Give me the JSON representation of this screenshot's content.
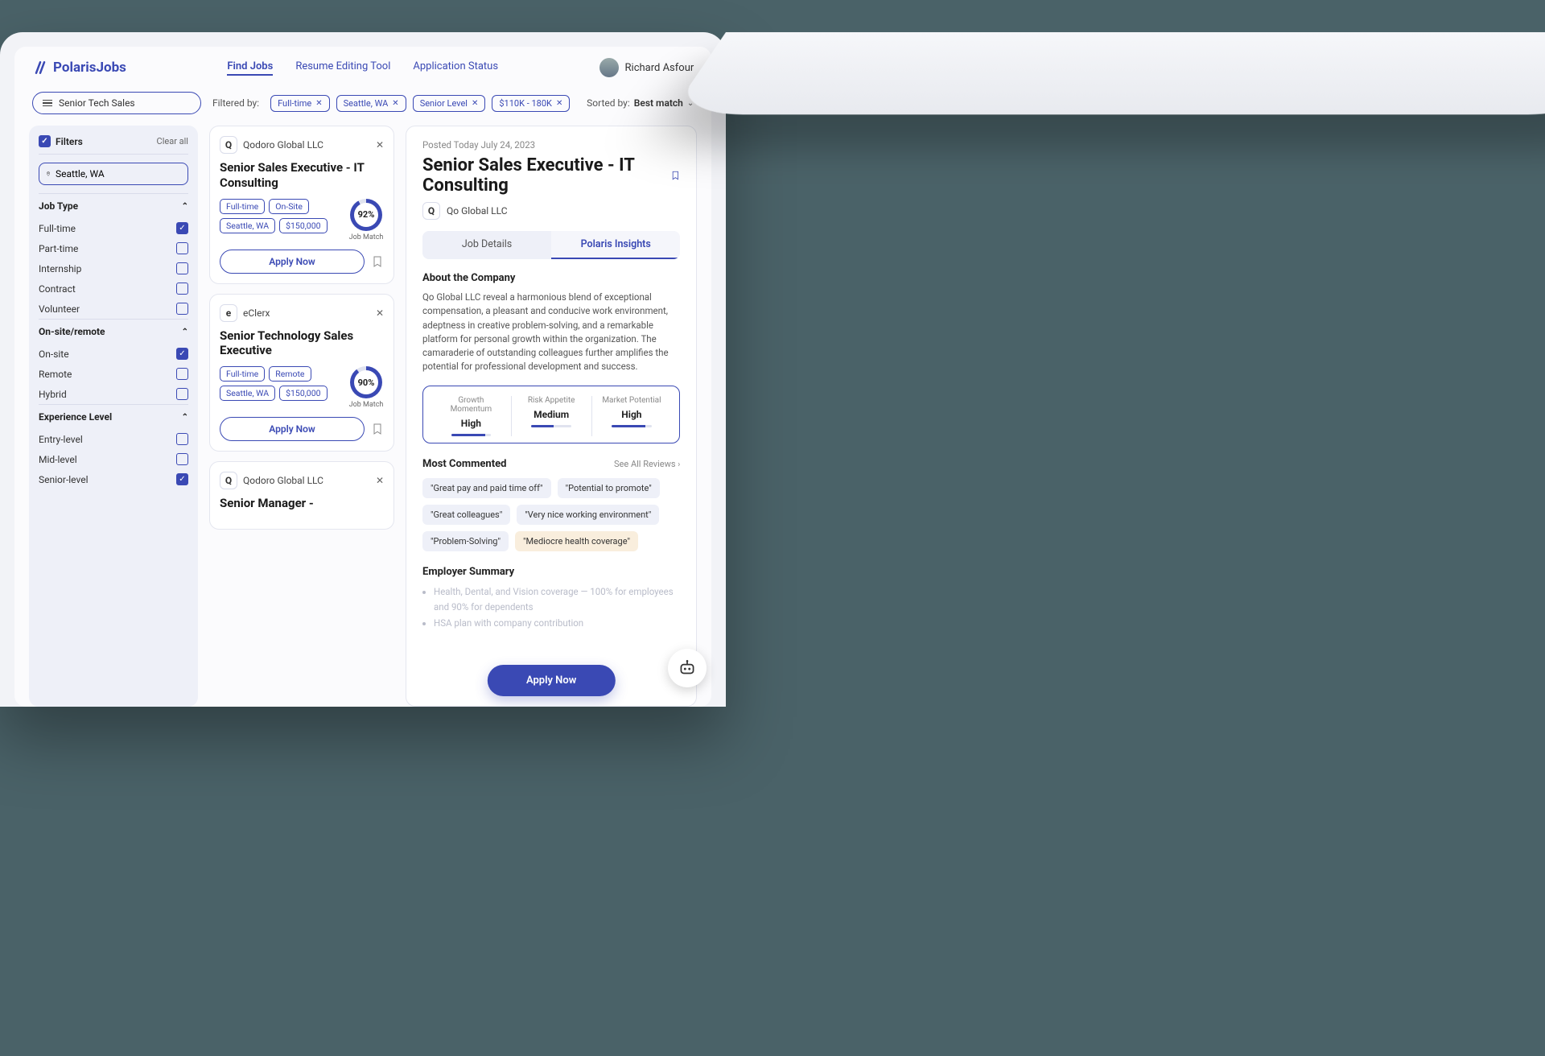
{
  "brand": "PolarisJobs",
  "nav": {
    "find": "Find Jobs",
    "resume": "Resume Editing Tool",
    "status": "Application Status"
  },
  "user": "Richard Asfour",
  "search": {
    "value": "Senior Tech Sales"
  },
  "filteredByLabel": "Filtered by:",
  "chips": [
    "Full-time",
    "Seattle, WA",
    "Senior Level",
    "$110K - 180K"
  ],
  "sort": {
    "label": "Sorted by:",
    "value": "Best match"
  },
  "filters": {
    "title": "Filters",
    "clear": "Clear all",
    "location": "Seattle, WA",
    "groups": [
      {
        "title": "Job Type",
        "items": [
          {
            "label": "Full-time",
            "checked": true
          },
          {
            "label": "Part-time",
            "checked": false
          },
          {
            "label": "Internship",
            "checked": false
          },
          {
            "label": "Contract",
            "checked": false
          },
          {
            "label": "Volunteer",
            "checked": false
          }
        ]
      },
      {
        "title": "On-site/remote",
        "items": [
          {
            "label": "On-site",
            "checked": true
          },
          {
            "label": "Remote",
            "checked": false
          },
          {
            "label": "Hybrid",
            "checked": false
          }
        ]
      },
      {
        "title": "Experience Level",
        "items": [
          {
            "label": "Entry-level",
            "checked": false
          },
          {
            "label": "Mid-level",
            "checked": false
          },
          {
            "label": "Senior-level",
            "checked": true
          }
        ]
      }
    ]
  },
  "jobs": [
    {
      "logo": "Q",
      "company": "Qodoro Global LLC",
      "title": "Senior Sales Executive - IT Consulting",
      "tags": [
        "Full-time",
        "On-Site",
        "Seattle, WA",
        "$150,000"
      ],
      "match": "92%",
      "matchPct": 92,
      "matchLabel": "Job Match",
      "apply": "Apply Now"
    },
    {
      "logo": "e",
      "company": "eClerx",
      "title": "Senior Technology Sales Executive",
      "tags": [
        "Full-time",
        "Remote",
        "Seattle, WA",
        "$150,000"
      ],
      "match": "90%",
      "matchPct": 90,
      "matchLabel": "Job Match",
      "apply": "Apply Now"
    },
    {
      "logo": "Q",
      "company": "Qodoro Global LLC",
      "title": "Senior Manager -",
      "tags": [],
      "match": "",
      "matchPct": 0,
      "matchLabel": "",
      "apply": ""
    }
  ],
  "detail": {
    "posted": "Posted Today July 24, 2023",
    "title": "Senior Sales Executive - IT Consulting",
    "companyLogo": "Q",
    "company": "Qo Global LLC",
    "tabs": {
      "a": "Job Details",
      "b": "Polaris Insights"
    },
    "aboutH": "About the Company",
    "about": "Qo Global LLC reveal a harmonious blend of exceptional compensation, a pleasant and conducive work environment, adeptness in creative problem-solving, and a remarkable platform for personal growth within the organization. The camaraderie of outstanding colleagues further amplifies the potential for professional development and success.",
    "metrics": [
      {
        "label": "Growth Momentum",
        "value": "High",
        "pct": 85
      },
      {
        "label": "Risk Appetite",
        "value": "Medium",
        "pct": 55
      },
      {
        "label": "Market Potential",
        "value": "High",
        "pct": 85
      }
    ],
    "mcH": "Most Commented",
    "seeAll": "See All Reviews",
    "comments": [
      {
        "t": "\"Great pay and paid time off\"",
        "neg": false
      },
      {
        "t": "\"Potential to promote\"",
        "neg": false
      },
      {
        "t": "\"Great colleagues\"",
        "neg": false
      },
      {
        "t": "\"Very nice working environment\"",
        "neg": false
      },
      {
        "t": "\"Problem-Solving\"",
        "neg": false
      },
      {
        "t": "\"Mediocre health coverage\"",
        "neg": true
      }
    ],
    "esH": "Employer Summary",
    "esItems": [
      "Health, Dental, and Vision coverage — 100% for employees and 90% for dependents",
      "HSA plan with company contribution"
    ],
    "applyBig": "Apply Now"
  }
}
